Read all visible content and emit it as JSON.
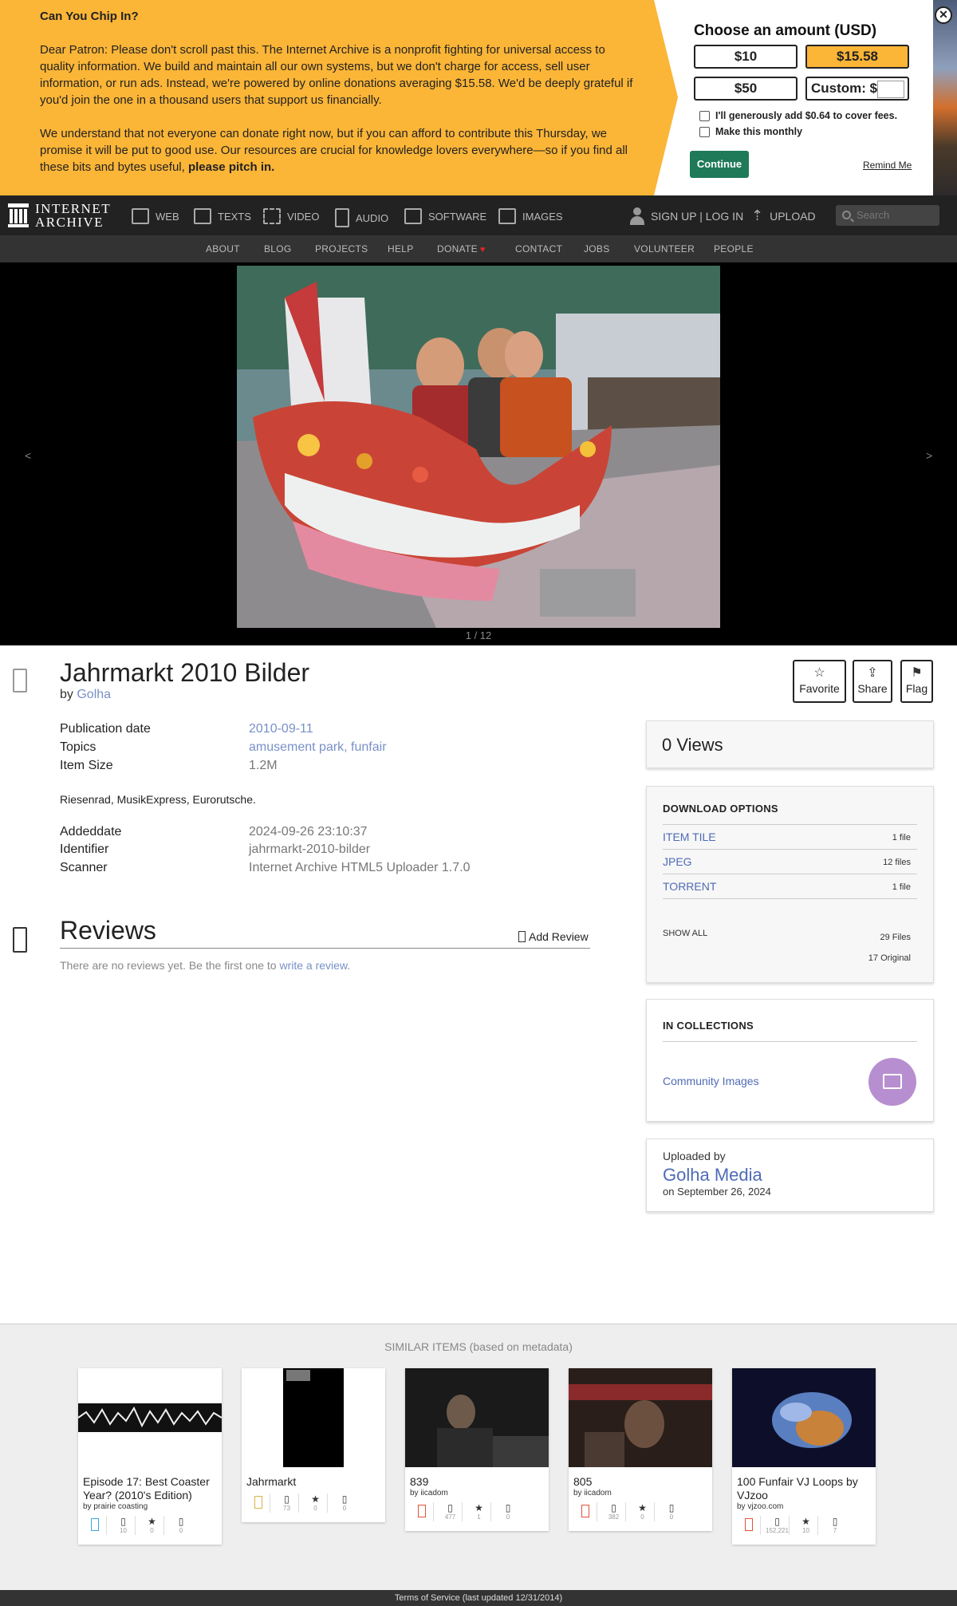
{
  "banner": {
    "heading": "Can You Chip In?",
    "paragraph1": "Dear Patron: Please don't scroll past this. The Internet Archive is a nonprofit fighting for universal access to quality information. We build and maintain all our own systems, but we don't charge for access, sell user information, or run ads. Instead, we're powered by online donations averaging $15.58. We'd be deeply grateful if you'd join the one in a thousand users that support us financially.",
    "paragraph2_prefix": "We understand that not everyone can donate right now, but if you can afford to contribute this Thursday, we promise it will be put to good use. Our resources are crucial for knowledge lovers everywhere—so if you find all these bits and bytes useful, ",
    "paragraph2_bold": "please pitch in.",
    "amount_title": "Choose an amount (USD)",
    "amounts": [
      "$10",
      "$15.58",
      "$50",
      "Custom: $"
    ],
    "selected_amount": "$15.58",
    "checkbox_fees": "I'll generously add $0.64 to cover fees.",
    "checkbox_monthly": "Make this monthly",
    "continue_label": "Continue",
    "remind_label": "Remind Me",
    "close_glyph": "✕",
    "accent_color": "#fbb537"
  },
  "nav": {
    "logo_line1": "INTERNET",
    "logo_line2": "ARCHIVE",
    "items": [
      {
        "label": "WEB",
        "icon": "web-icon"
      },
      {
        "label": "TEXTS",
        "icon": "book-icon"
      },
      {
        "label": "VIDEO",
        "icon": "film-icon"
      },
      {
        "label": "AUDIO",
        "icon": "speaker-icon"
      },
      {
        "label": "SOFTWARE",
        "icon": "floppy-icon"
      },
      {
        "label": "IMAGES",
        "icon": "image-icon"
      }
    ],
    "signup": "SIGN UP | LOG IN",
    "upload": "UPLOAD",
    "search_placeholder": "Search"
  },
  "subnav": {
    "items": [
      "ABOUT",
      "BLOG",
      "PROJECTS",
      "HELP",
      "DONATE",
      "CONTACT",
      "JOBS",
      "VOLUNTEER",
      "PEOPLE"
    ],
    "donate_heart": "♥"
  },
  "theater": {
    "prev": "<",
    "next": ">",
    "counter": "1 / 12"
  },
  "item": {
    "title": "Jahrmarkt 2010 Bilder",
    "by_prefix": "by",
    "creator": "Golha",
    "metadata": [
      {
        "label": "Publication date",
        "value": "2010-09-11"
      },
      {
        "label": "Topics",
        "value": "amusement park, funfair"
      },
      {
        "label": "Item Size",
        "value": "1.2M"
      }
    ],
    "description": "Riesenrad, MusikExpress, Eurorutsche.",
    "metadata2": [
      {
        "label": "Addeddate",
        "value": "2024-09-26 23:10:37"
      },
      {
        "label": "Identifier",
        "value": "jahrmarkt-2010-bilder"
      },
      {
        "label": "Scanner",
        "value": "Internet Archive HTML5 Uploader 1.7.0"
      }
    ],
    "actions": [
      {
        "label": "Favorite",
        "glyph": "☆"
      },
      {
        "label": "Share",
        "glyph": "⇪"
      },
      {
        "label": "Flag",
        "glyph": "⚑"
      }
    ]
  },
  "reviews": {
    "title": "Reviews",
    "add_label": "Add Review",
    "empty_prefix": "There are no reviews yet. Be the first one to ",
    "empty_link": "write a review",
    "empty_suffix": "."
  },
  "sidebar": {
    "views": "0 Views",
    "download_heading": "DOWNLOAD OPTIONS",
    "downloads": [
      {
        "name": "ITEM TILE",
        "count": "1 file"
      },
      {
        "name": "JPEG",
        "count": "12 files"
      },
      {
        "name": "TORRENT",
        "count": "1 file"
      }
    ],
    "show_all": "SHOW ALL",
    "files_total": "29 Files",
    "files_original": "17 Original",
    "collections_heading": "IN COLLECTIONS",
    "collection": "Community Images",
    "uploaded_by_label": "Uploaded by",
    "uploader": "Golha Media",
    "upload_date": "on September 26, 2024"
  },
  "similar": {
    "title": "SIMILAR ITEMS (based on metadata)",
    "items": [
      {
        "title": "Episode 17: Best Coaster Year? (2010's Edition)",
        "by": "by prairie coasting",
        "views": "10",
        "favs": "0",
        "reviews": "0"
      },
      {
        "title": "Jahrmarkt",
        "by": "",
        "views": "73",
        "favs": "0",
        "reviews": "0"
      },
      {
        "title": "839",
        "by": "by iicadom",
        "views": "477",
        "favs": "1",
        "reviews": "0"
      },
      {
        "title": "805",
        "by": "by iicadom",
        "views": "382",
        "favs": "0",
        "reviews": "0"
      },
      {
        "title": "100 Funfair VJ Loops by VJzoo",
        "by": "by vjzoo.com",
        "views": "152,221",
        "favs": "10",
        "reviews": "7"
      }
    ]
  },
  "footer": {
    "text": "Terms of Service (last updated 12/31/2014)"
  }
}
